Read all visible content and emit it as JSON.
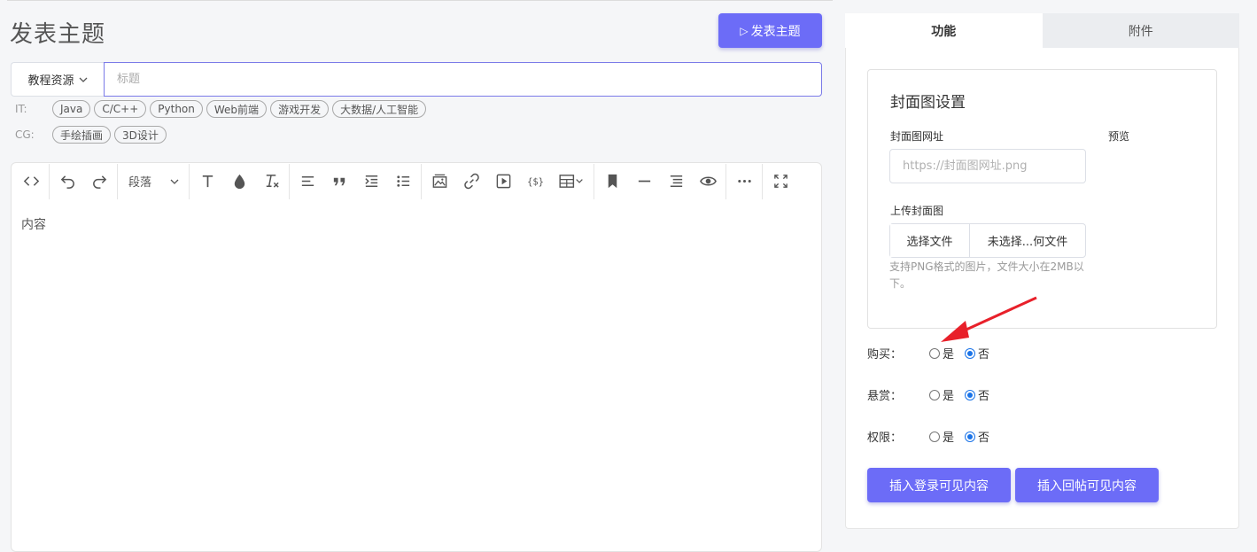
{
  "page": {
    "title": "发表主题"
  },
  "publish_button": {
    "icon": "send-triangle-icon",
    "label": "发表主题"
  },
  "category": {
    "selected": "教程资源"
  },
  "title_input": {
    "placeholder": "标题",
    "value": ""
  },
  "tag_groups": [
    {
      "label": "IT:",
      "tags": [
        "Java",
        "C/C++",
        "Python",
        "Web前端",
        "游戏开发",
        "大数据/人工智能"
      ]
    },
    {
      "label": "CG:",
      "tags": [
        "手绘插画",
        "3D设计"
      ]
    }
  ],
  "editor": {
    "paragraph_select": "段落",
    "placeholder": "内容",
    "toolbar_icons": [
      "code-view-icon",
      "undo-icon",
      "redo-icon",
      "font-size-icon",
      "color-drop-icon",
      "clear-format-icon",
      "align-left-icon",
      "quote-icon",
      "indent-icon",
      "bullet-list-icon",
      "image-icon",
      "link-icon",
      "video-icon",
      "code-block-icon",
      "table-icon",
      "bookmark-icon",
      "horizontal-rule-icon",
      "toc-icon",
      "preview-eye-icon",
      "more-icon",
      "fullscreen-icon"
    ]
  },
  "side_tabs": [
    {
      "label": "功能",
      "active": true
    },
    {
      "label": "附件",
      "active": false
    }
  ],
  "cover": {
    "title": "封面图设置",
    "url_label": "封面图网址",
    "url_placeholder": "https://封面图网址.png",
    "preview_label": "预览",
    "upload_label": "上传封面图",
    "choose_file": "选择文件",
    "no_file": "未选择...何文件",
    "hint": "支持PNG格式的图片，文件大小在2MB以下。"
  },
  "options": [
    {
      "label": "购买：",
      "yes": "是",
      "no": "否",
      "selected": "no"
    },
    {
      "label": "悬赏：",
      "yes": "是",
      "no": "否",
      "selected": "no"
    },
    {
      "label": "权限：",
      "yes": "是",
      "no": "否",
      "selected": "no"
    }
  ],
  "buttons": {
    "insert_login": "插入登录可见内容",
    "insert_reply": "插入回帖可见内容"
  },
  "colors": {
    "accent": "#6c6cf7",
    "radio_checked": "#1a73e8",
    "annotation_arrow": "#e8202a"
  }
}
